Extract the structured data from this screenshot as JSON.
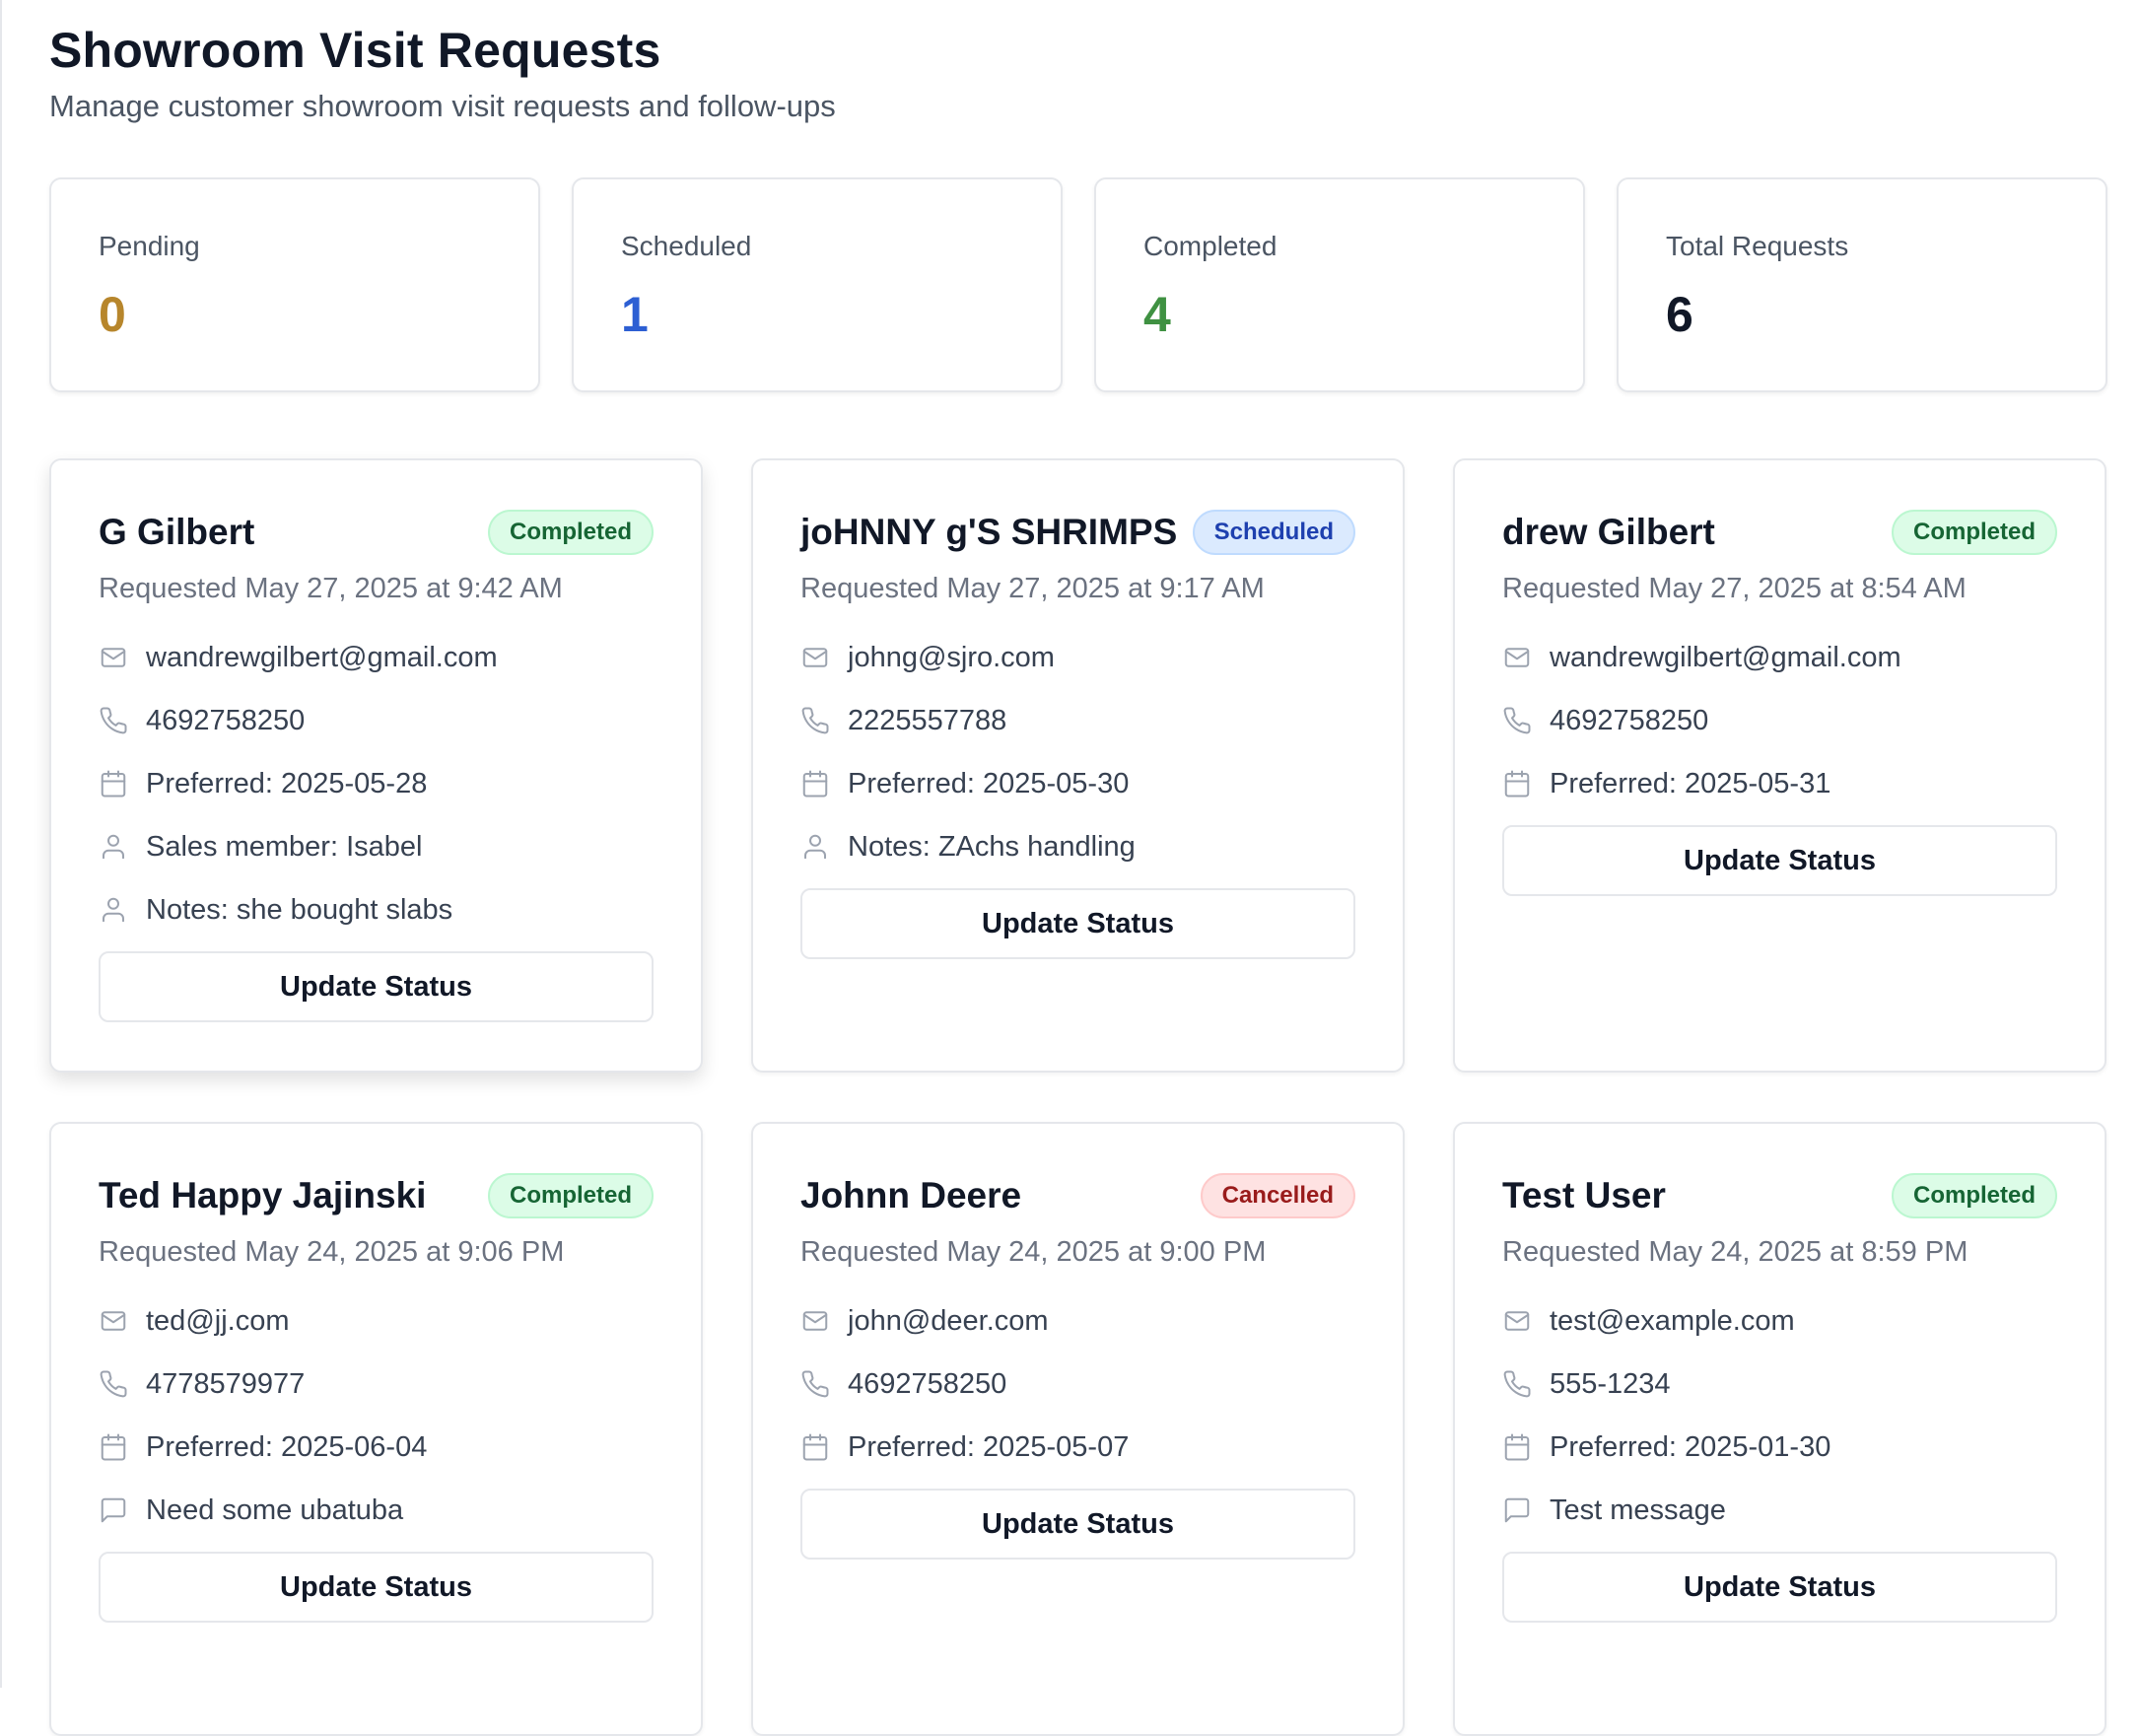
{
  "header": {
    "title": "Showroom Visit Requests",
    "subtitle": "Manage customer showroom visit requests and follow-ups"
  },
  "stats": [
    {
      "label": "Pending",
      "value": "0",
      "color": "#b7862c"
    },
    {
      "label": "Scheduled",
      "value": "1",
      "color": "#2d5fd3"
    },
    {
      "label": "Completed",
      "value": "4",
      "color": "#3f9142"
    },
    {
      "label": "Total Requests",
      "value": "6",
      "color": "#111827"
    }
  ],
  "colors": {
    "completed_badge": "#dcfce7",
    "scheduled_badge": "#dbeafe",
    "cancelled_badge": "#fee2e2",
    "icon": "#9ca3af"
  },
  "requests": [
    {
      "name": "G Gilbert",
      "status": "Completed",
      "requested": "Requested May 27, 2025 at 9:42 AM",
      "details": [
        {
          "icon": "mail-icon",
          "text": "wandrewgilbert@gmail.com"
        },
        {
          "icon": "phone-icon",
          "text": "4692758250"
        },
        {
          "icon": "calendar-icon",
          "text": "Preferred: 2025-05-28"
        },
        {
          "icon": "user-icon",
          "text": "Sales member: Isabel"
        },
        {
          "icon": "user-icon",
          "text": "Notes: she bought slabs"
        }
      ],
      "button": "Update Status"
    },
    {
      "name": "joHNNY g'S SHRIMPS",
      "status": "Scheduled",
      "requested": "Requested May 27, 2025 at 9:17 AM",
      "details": [
        {
          "icon": "mail-icon",
          "text": "johng@sjro.com"
        },
        {
          "icon": "phone-icon",
          "text": "2225557788"
        },
        {
          "icon": "calendar-icon",
          "text": "Preferred: 2025-05-30"
        },
        {
          "icon": "user-icon",
          "text": "Notes: ZAchs handling"
        }
      ],
      "button": "Update Status"
    },
    {
      "name": "drew Gilbert",
      "status": "Completed",
      "requested": "Requested May 27, 2025 at 8:54 AM",
      "details": [
        {
          "icon": "mail-icon",
          "text": "wandrewgilbert@gmail.com"
        },
        {
          "icon": "phone-icon",
          "text": "4692758250"
        },
        {
          "icon": "calendar-icon",
          "text": "Preferred: 2025-05-31"
        }
      ],
      "button": "Update Status"
    },
    {
      "name": "Ted Happy Jajinski",
      "status": "Completed",
      "requested": "Requested May 24, 2025 at 9:06 PM",
      "details": [
        {
          "icon": "mail-icon",
          "text": "ted@jj.com"
        },
        {
          "icon": "phone-icon",
          "text": "4778579977"
        },
        {
          "icon": "calendar-icon",
          "text": "Preferred: 2025-06-04"
        },
        {
          "icon": "message-icon",
          "text": "Need some ubatuba"
        }
      ],
      "button": "Update Status"
    },
    {
      "name": "Johnn Deere",
      "status": "Cancelled",
      "requested": "Requested May 24, 2025 at 9:00 PM",
      "details": [
        {
          "icon": "mail-icon",
          "text": "john@deer.com"
        },
        {
          "icon": "phone-icon",
          "text": "4692758250"
        },
        {
          "icon": "calendar-icon",
          "text": "Preferred: 2025-05-07"
        }
      ],
      "button": "Update Status"
    },
    {
      "name": "Test User",
      "status": "Completed",
      "requested": "Requested May 24, 2025 at 8:59 PM",
      "details": [
        {
          "icon": "mail-icon",
          "text": "test@example.com"
        },
        {
          "icon": "phone-icon",
          "text": "555-1234"
        },
        {
          "icon": "calendar-icon",
          "text": "Preferred: 2025-01-30"
        },
        {
          "icon": "message-icon",
          "text": "Test message"
        }
      ],
      "button": "Update Status"
    }
  ]
}
